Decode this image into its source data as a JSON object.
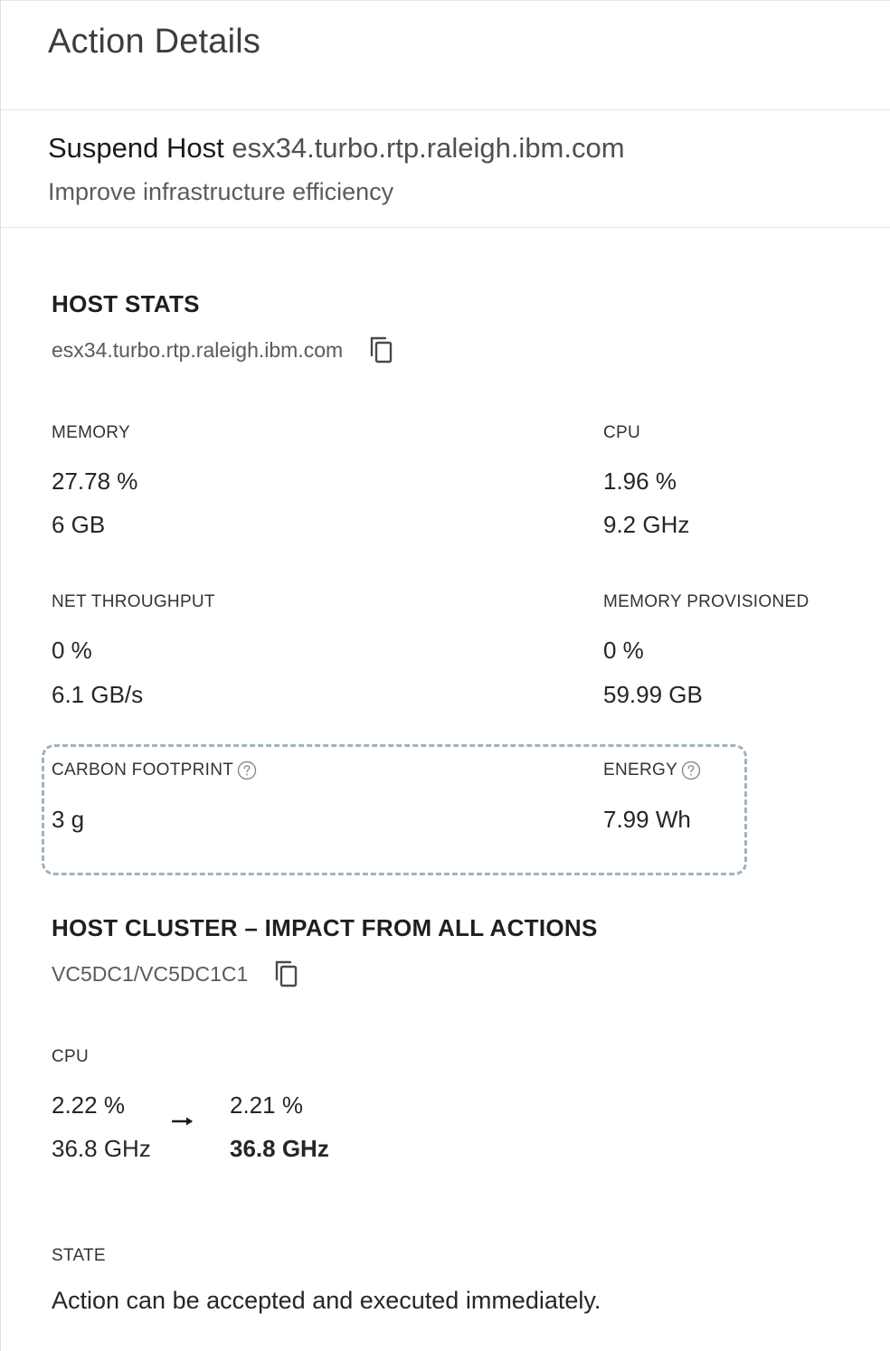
{
  "header": {
    "title": "Action Details"
  },
  "summary": {
    "action": "Suspend Host",
    "target": "esx34.turbo.rtp.raleigh.ibm.com",
    "reason": "Improve infrastructure efficiency"
  },
  "host_stats": {
    "title": "HOST STATS",
    "entity": "esx34.turbo.rtp.raleigh.ibm.com",
    "memory": {
      "label": "MEMORY",
      "percent": "27.78 %",
      "capacity": "6 GB"
    },
    "cpu": {
      "label": "CPU",
      "percent": "1.96 %",
      "capacity": "9.2 GHz"
    },
    "net_throughput": {
      "label": "NET THROUGHPUT",
      "percent": "0 %",
      "capacity": "6.1 GB/s"
    },
    "memory_provisioned": {
      "label": "MEMORY PROVISIONED",
      "percent": "0 %",
      "capacity": "59.99 GB"
    },
    "carbon_footprint": {
      "label": "CARBON FOOTPRINT",
      "value": "3 g"
    },
    "energy": {
      "label": "ENERGY",
      "value": "7.99 Wh"
    }
  },
  "cluster": {
    "title": "HOST CLUSTER – IMPACT FROM ALL ACTIONS",
    "entity": "VC5DC1/VC5DC1C1",
    "cpu": {
      "label": "CPU",
      "before_percent": "2.22 %",
      "before_capacity": "36.8 GHz",
      "after_percent": "2.21 %",
      "after_capacity": "36.8 GHz"
    }
  },
  "state": {
    "label": "STATE",
    "text": "Action can be accepted and executed immediately."
  },
  "icons": {
    "copy": "copy-icon",
    "help": "help-circle-icon",
    "arrow": "arrow-right-icon"
  },
  "colors": {
    "carbon_box_border": "#9db3c2",
    "divider": "#e2e5e8"
  }
}
